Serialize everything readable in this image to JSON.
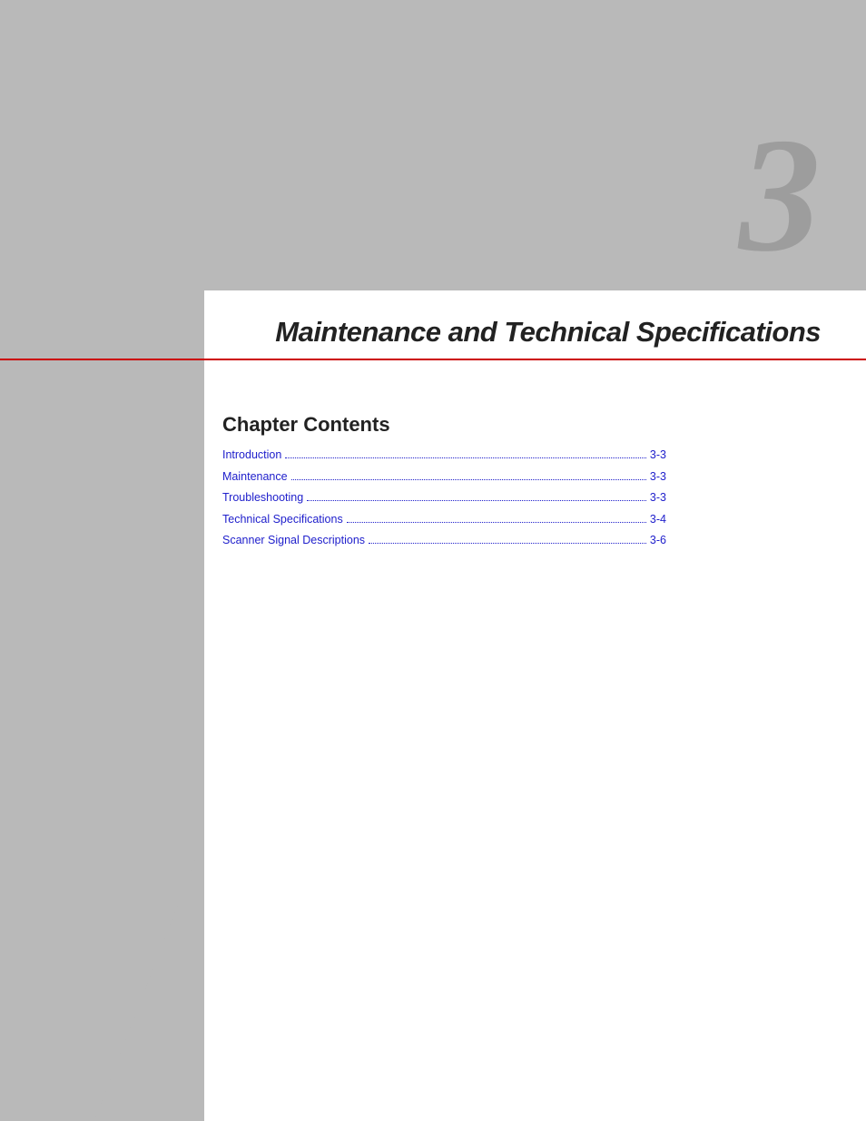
{
  "chapter_number": "3",
  "chapter_title": "Maintenance and Technical Specifications",
  "contents_heading": "Chapter Contents",
  "toc": [
    {
      "label": "Introduction",
      "page": "3-3"
    },
    {
      "label": "Maintenance",
      "page": "3-3"
    },
    {
      "label": "Troubleshooting",
      "page": "3-3"
    },
    {
      "label": "Technical Specifications",
      "page": "3-4"
    },
    {
      "label": "Scanner Signal Descriptions",
      "page": "3-6"
    }
  ]
}
